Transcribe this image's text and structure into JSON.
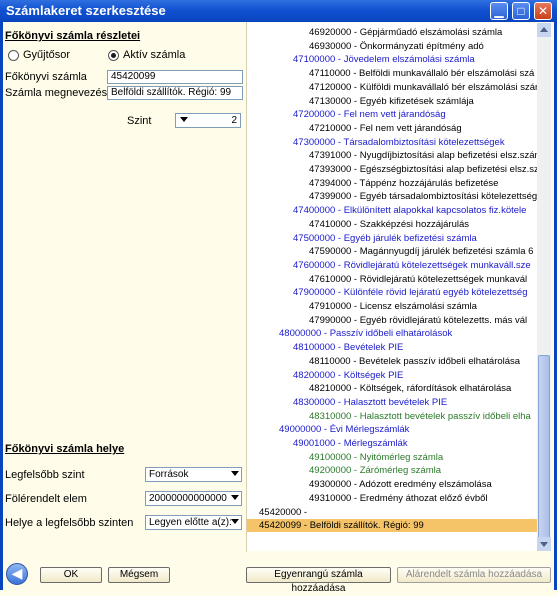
{
  "window": {
    "title": "Számlakeret szerkesztése"
  },
  "details": {
    "section_title": "Főkönyvi számla részletei",
    "radio_collector": "Gyűjtősor",
    "radio_active": "Aktív számla",
    "account_label": "Főkönyvi számla",
    "account_value": "45420099",
    "name_label": "Számla megnevezése",
    "name_value": "Belföldi szállítók. Régió: 99",
    "level_label": "Szint",
    "level_value": "2"
  },
  "location": {
    "section_title": "Főkönyvi számla helye",
    "top_level_label": "Legfelsőbb szint",
    "top_level_value": "Források",
    "parent_label": "Fölérendelt elem",
    "parent_value": "20000000000000",
    "position_label": "Helye a legfelsőbb szinten",
    "position_value": "Legyen előtte a(z):"
  },
  "tree": [
    {
      "text": "46920000 - Gépjárműadó elszámolási számla",
      "indent": 3,
      "color": "black"
    },
    {
      "text": "46930000 - Önkormányzati építmény adó",
      "indent": 3,
      "color": "black"
    },
    {
      "text": "47100000 - Jövedelem elszámolási számla",
      "indent": 2,
      "color": "blue"
    },
    {
      "text": "47110000 - Belföldi munkavállaló bér elszámolási szá",
      "indent": 3,
      "color": "black"
    },
    {
      "text": "47120000 - Külföldi munkavállaló bér elszámolási szám",
      "indent": 3,
      "color": "black"
    },
    {
      "text": "47130000 - Egyéb kifizetések számlája",
      "indent": 3,
      "color": "black"
    },
    {
      "text": "47200000 - Fel nem vett járandóság",
      "indent": 2,
      "color": "blue"
    },
    {
      "text": "47210000 - Fel nem vett járandóság",
      "indent": 3,
      "color": "black"
    },
    {
      "text": "47300000 - Társadalombiztosítási kötelezettségek",
      "indent": 2,
      "color": "blue"
    },
    {
      "text": "47391000 - Nyugdíjbiztosítási alap befizetési elsz.szám",
      "indent": 3,
      "color": "black"
    },
    {
      "text": "47393000 - Egészségbiztosítási alap befizetési elsz.szá",
      "indent": 3,
      "color": "black"
    },
    {
      "text": "47394000 - Táppénz hozzájárulás befizetése",
      "indent": 3,
      "color": "black"
    },
    {
      "text": "47399000 - Egyéb társadalombiztosítási kötelezettsége",
      "indent": 3,
      "color": "black"
    },
    {
      "text": "47400000 - Elkülönített alapokkal kapcsolatos fiz.kötele",
      "indent": 2,
      "color": "blue"
    },
    {
      "text": "47410000 - Szakképzési hozzájárulás",
      "indent": 3,
      "color": "black"
    },
    {
      "text": "47500000 - Egyéb járulék befizetési számla",
      "indent": 2,
      "color": "blue"
    },
    {
      "text": "47590000 - Magánnyugdíj járulék befizetési számla 6",
      "indent": 3,
      "color": "black"
    },
    {
      "text": "47600000 - Rövidlejáratú kötelezettségek munkaváll.sze",
      "indent": 2,
      "color": "blue"
    },
    {
      "text": "47610000 - Rövidlejáratú kötelezettségek munkavál",
      "indent": 3,
      "color": "black"
    },
    {
      "text": "47900000 - Különféle rövid lejáratú egyéb kötelezettség",
      "indent": 2,
      "color": "blue"
    },
    {
      "text": "47910000 - Licensz elszámolási számla",
      "indent": 3,
      "color": "black"
    },
    {
      "text": "47990000 - Egyéb rövidlejáratú kötelezetts. más vál",
      "indent": 3,
      "color": "black"
    },
    {
      "text": "48000000 - Passzív időbeli elhatárolások",
      "indent": 1,
      "color": "blue"
    },
    {
      "text": "48100000 - Bevételek PIE",
      "indent": 2,
      "color": "blue"
    },
    {
      "text": "48110000 - Bevételek passzív időbeli elhatárolása",
      "indent": 3,
      "color": "black"
    },
    {
      "text": "48200000 - Költségek PIE",
      "indent": 2,
      "color": "blue"
    },
    {
      "text": "48210000 - Költségek, ráfordítások elhatárolása",
      "indent": 3,
      "color": "black"
    },
    {
      "text": "48300000 - Halasztott bevételek PIE",
      "indent": 2,
      "color": "blue"
    },
    {
      "text": "48310000 - Halasztott bevételek passzív időbeli elha",
      "indent": 3,
      "color": "green"
    },
    {
      "text": "49000000 - Évi Mérlegszámlák",
      "indent": 1,
      "color": "blue"
    },
    {
      "text": "49001000 - Mérlegszámlák",
      "indent": 2,
      "color": "blue"
    },
    {
      "text": "49100000 - Nyitómérleg számla",
      "indent": 3,
      "color": "green"
    },
    {
      "text": "49200000 - Zárómérleg számla",
      "indent": 3,
      "color": "green"
    },
    {
      "text": "49300000 - Adózott eredmény elszámolása",
      "indent": 3,
      "color": "black"
    },
    {
      "text": "49310000 - Eredmény áthozat előző évből",
      "indent": 3,
      "color": "black"
    },
    {
      "text": "45420000 -",
      "indent": 0,
      "color": "black"
    },
    {
      "text": "45420099 - Belföldi szállítók. Régió: 99",
      "indent": 0,
      "color": "black",
      "selected": true
    }
  ],
  "buttons": {
    "ok": "OK",
    "cancel": "Mégsem",
    "add_sibling": "Egyenrangú számla hozzáadása",
    "add_child": "Alárendelt számla hozzáadása"
  },
  "colors": {
    "blue": "#1a1acc",
    "green": "#2a7a2a",
    "selected": "#F5C469",
    "background": "#FFFDE9"
  }
}
